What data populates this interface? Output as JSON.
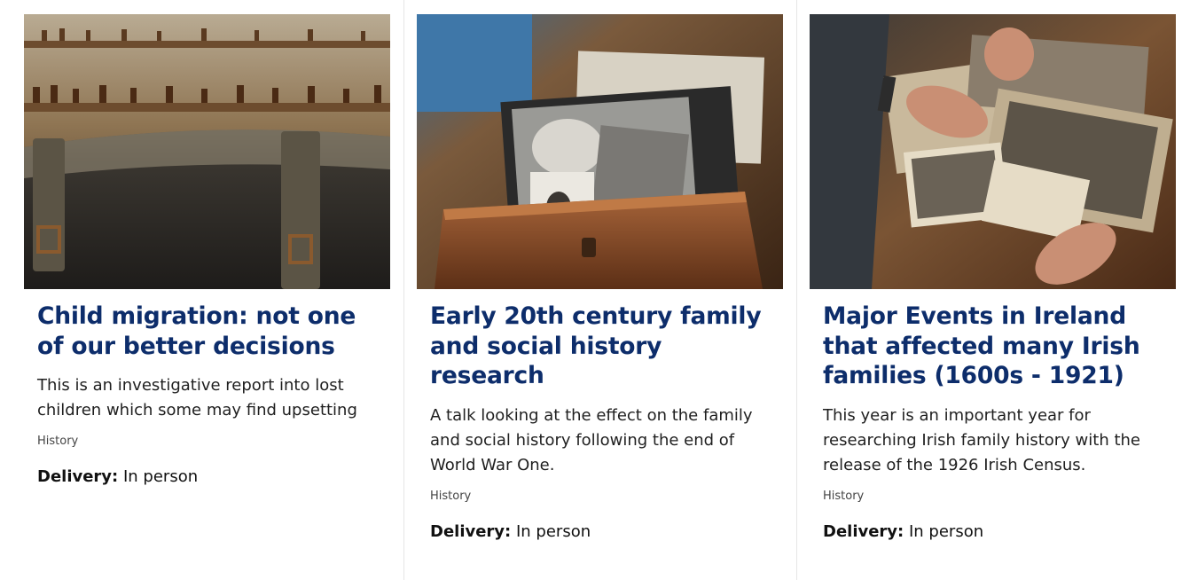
{
  "cards": [
    {
      "title": "Child migration: not one of our better decisions",
      "description": "This is an investigative report into lost children which some may find upsetting",
      "category": "History",
      "delivery_label": "Delivery:",
      "delivery_value": "In person"
    },
    {
      "title": "Early 20th century family and social history research",
      "description": "A talk looking at the effect on the family and social history following the end of World War One.",
      "category": "History",
      "delivery_label": "Delivery:",
      "delivery_value": "In person"
    },
    {
      "title": "Major Events in Ireland that affected many Irish families (1600s - 1921)",
      "description": "This year is an important year for researching Irish family history with the release of the 1926 Irish Census.",
      "category": "History",
      "delivery_label": "Delivery:",
      "delivery_value": "In person"
    }
  ],
  "colors": {
    "title": "#0d2d6b",
    "text": "#1f1f1f",
    "divider": "#e6e6e6"
  }
}
